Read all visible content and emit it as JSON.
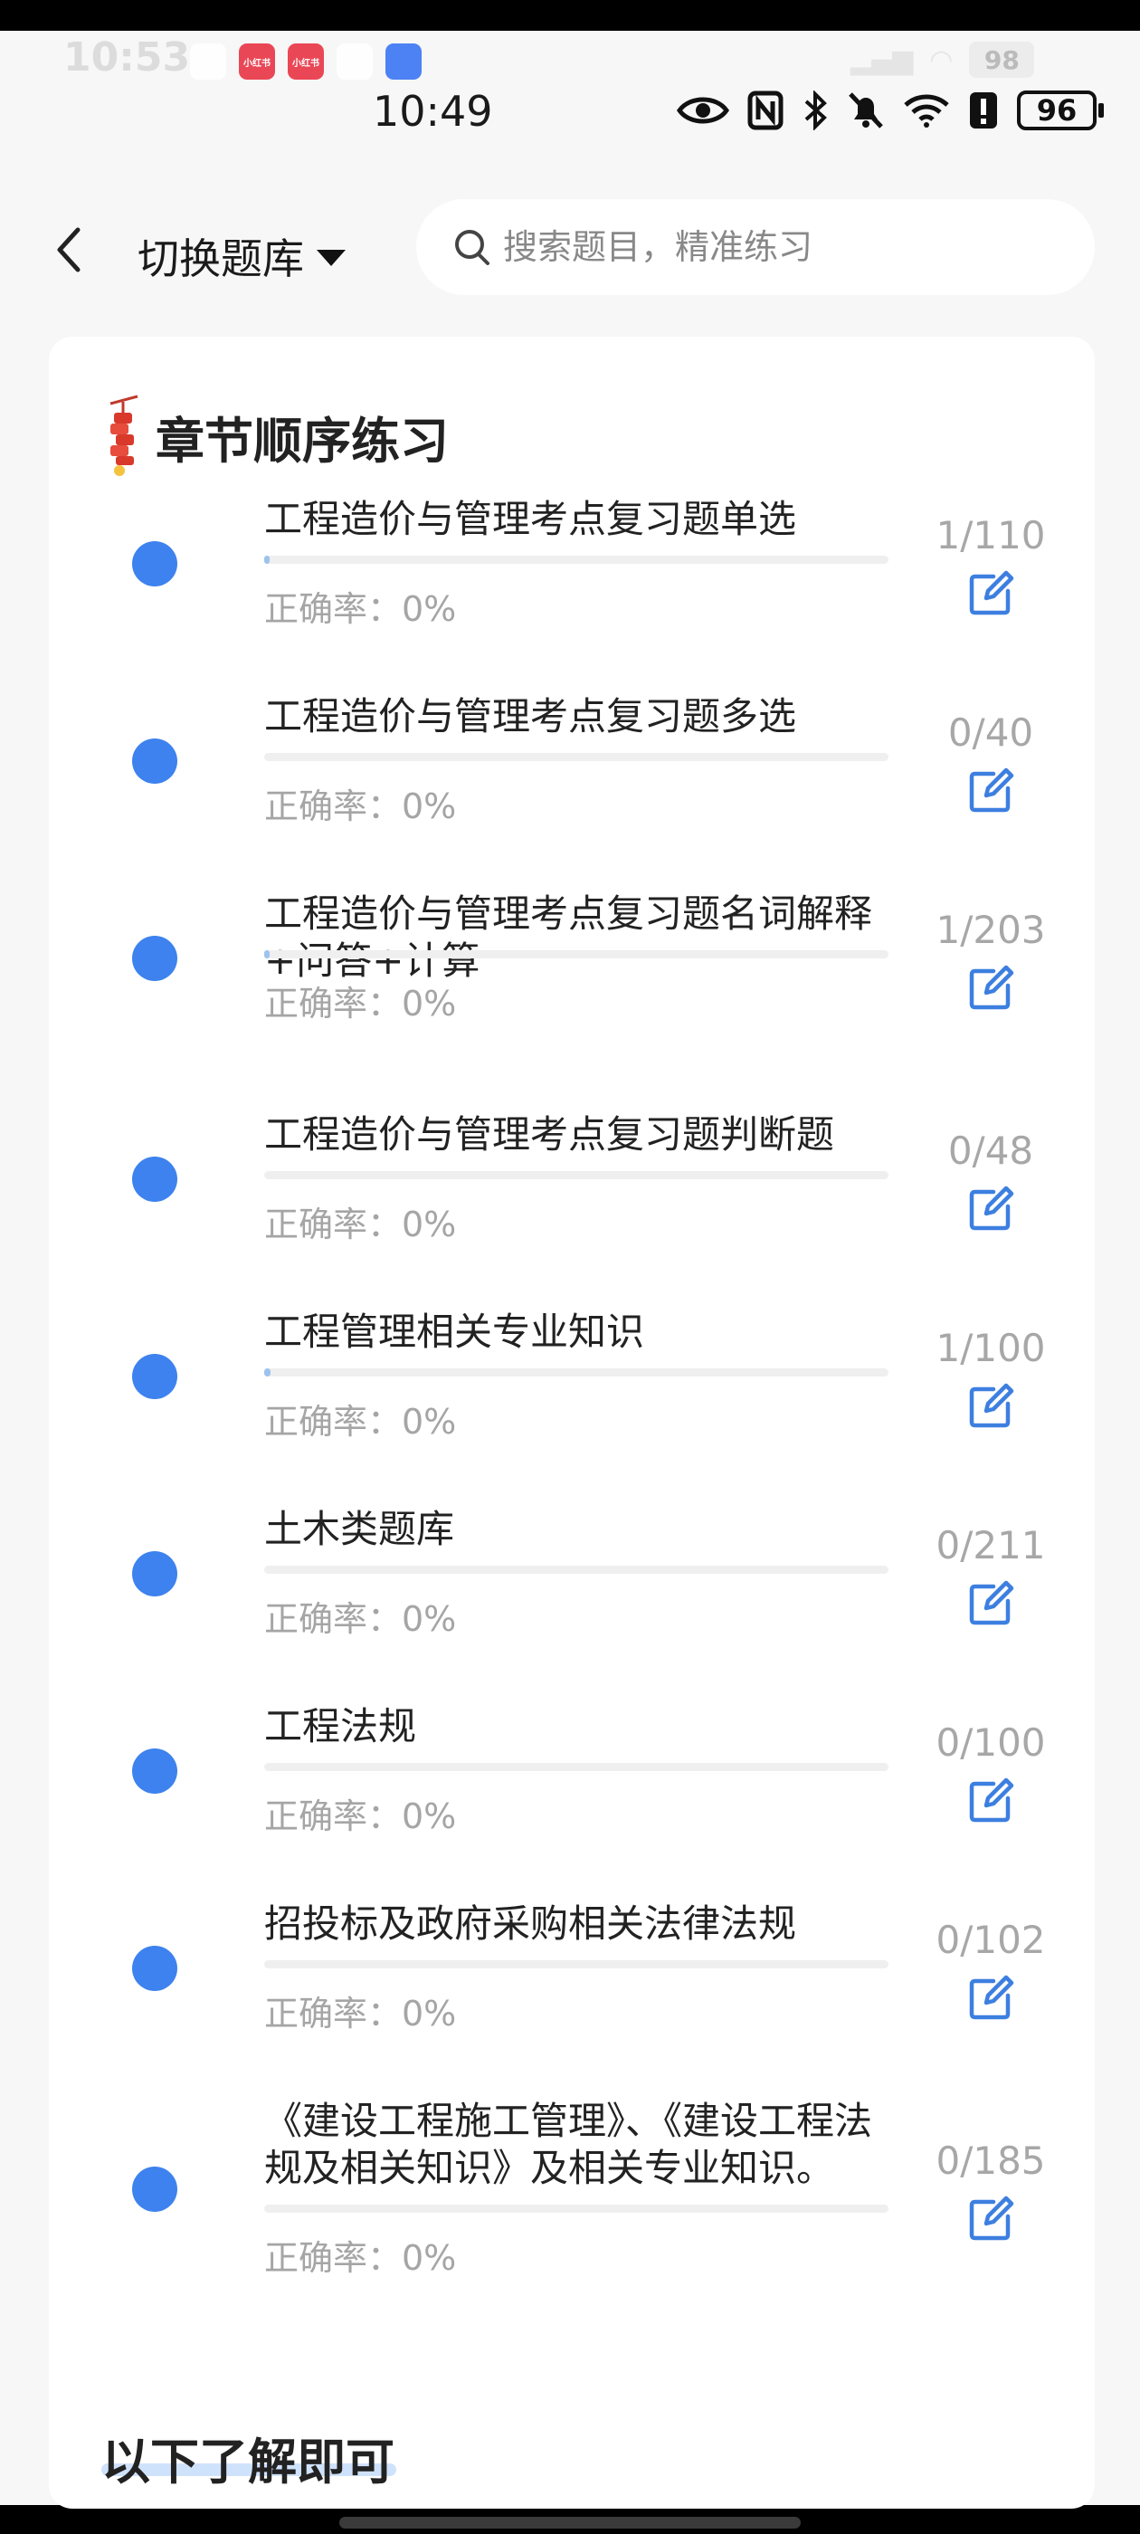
{
  "system": {
    "ghost_time": "10:53",
    "ghost_battery": "98",
    "ghost_apps": [
      {
        "name": "app-icon-search",
        "color": "#ffffff",
        "label": ""
      },
      {
        "name": "app-icon-xiaohongshu-1",
        "color": "#e8293b",
        "label": "小红书"
      },
      {
        "name": "app-icon-xiaohongshu-2",
        "color": "#e8293b",
        "label": "小红书"
      },
      {
        "name": "app-icon-a",
        "color": "#ffffff",
        "label": ""
      },
      {
        "name": "app-icon-u",
        "color": "#2f6df5",
        "label": ""
      }
    ],
    "time": "10:49",
    "battery": "96"
  },
  "header": {
    "switch_label": "切换题库",
    "search_placeholder": "搜索题目，精准练习"
  },
  "section": {
    "title": "章节顺序练习"
  },
  "accent_color": "#3d82ee",
  "chapters": [
    {
      "title": "工程造价与管理考点复习题单选",
      "accuracy": "正确率：0%",
      "count": "1/110",
      "progress": 0.009
    },
    {
      "title": "工程造价与管理考点复习题多选",
      "accuracy": "正确率：0%",
      "count": "0/40",
      "progress": 0
    },
    {
      "title": "工程造价与管理考点复习题名词解释+问答+计算",
      "accuracy": "正确率：0%",
      "count": "1/203",
      "progress": 0.005
    },
    {
      "title": "工程造价与管理考点复习题判断题",
      "accuracy": "正确率：0%",
      "count": "0/48",
      "progress": 0
    },
    {
      "title": "工程管理相关专业知识",
      "accuracy": "正确率：0%",
      "count": "1/100",
      "progress": 0.01
    },
    {
      "title": "土木类题库",
      "accuracy": "正确率：0%",
      "count": "0/211",
      "progress": 0
    },
    {
      "title": "工程法规",
      "accuracy": "正确率：0%",
      "count": "0/100",
      "progress": 0
    },
    {
      "title": "招投标及政府采购相关法律法规",
      "accuracy": "正确率：0%",
      "count": "0/102",
      "progress": 0
    },
    {
      "title": "《建设工程施工管理》、《建设工程法规及相关知识》及相关专业知识。",
      "accuracy": "正确率：0%",
      "count": "0/185",
      "progress": 0
    }
  ],
  "footer": {
    "title": "以下了解即可"
  }
}
